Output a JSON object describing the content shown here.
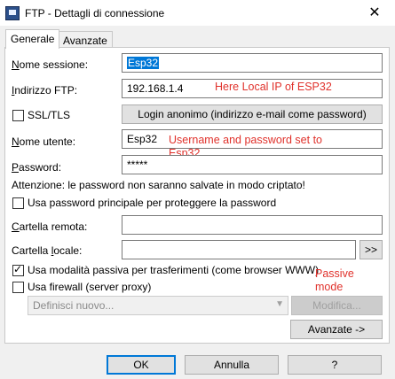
{
  "window": {
    "title": "FTP - Dettagli di connessione",
    "close": "✕"
  },
  "tabs": [
    {
      "label": "Generale"
    },
    {
      "label": "Avanzate"
    }
  ],
  "fields": {
    "session_name": {
      "label_u": "N",
      "label_rest": "ome sessione:",
      "value": "Esp32"
    },
    "ftp_address": {
      "label_u": "I",
      "label_rest": "ndirizzo FTP:",
      "value": "192.168.1.4"
    },
    "ssl": {
      "label": "SSL/TLS",
      "checked": false
    },
    "anon_login": {
      "label": "Login anonimo (indirizzo e-mail come password)"
    },
    "username": {
      "label_u": "N",
      "label_rest": "ome utente:",
      "value": "Esp32"
    },
    "password": {
      "label_u": "P",
      "label_rest": "assword:",
      "value": "*****"
    },
    "warning": "Attenzione: le password non saranno salvate in modo criptato!",
    "master_pw": {
      "label": "Usa password principale per proteggere la password",
      "checked": false
    },
    "remote_folder": {
      "label_u": "C",
      "label_rest": "artella remota:",
      "value": ""
    },
    "local_folder": {
      "label_pre": "Cartella ",
      "label_u": "l",
      "label_rest": "ocale:",
      "value": "",
      "browse": ">>"
    },
    "passive": {
      "label": "Usa modalità passiva per trasferimenti (come browser WWW)",
      "checked": true
    },
    "firewall": {
      "label": "Usa firewall (server proxy)",
      "checked": false
    },
    "proxy_select": {
      "value": "Definisci nuovo..."
    },
    "modify": {
      "label": "Modifica..."
    },
    "advanced": {
      "label": "Avanzate ->"
    }
  },
  "annotations": {
    "local_ip": "Here Local IP of ESP32",
    "credentials": "Username and password set to Esp32",
    "passive": "Passive mode"
  },
  "footer": {
    "ok": "OK",
    "cancel": "Annulla",
    "help": "?"
  },
  "colors": {
    "annotation": "#e0312b",
    "selection": "#0078d7"
  }
}
